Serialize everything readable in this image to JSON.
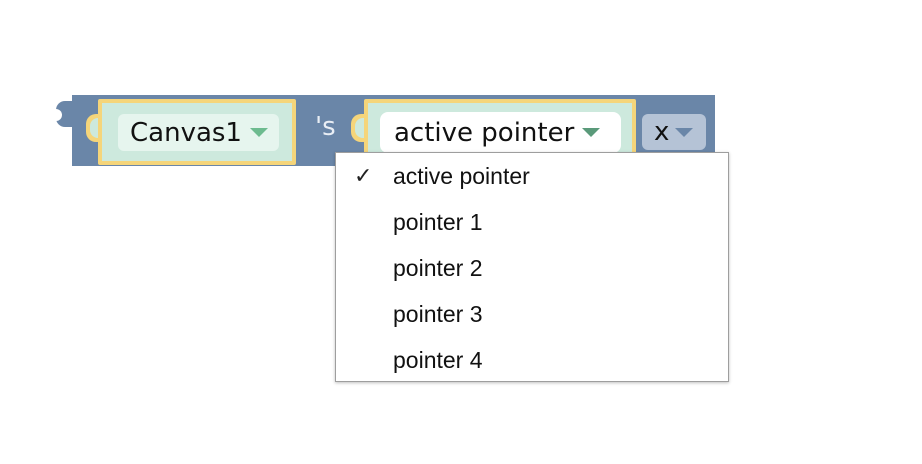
{
  "block": {
    "component": "Canvas1",
    "possessive": "'s",
    "property": "active pointer",
    "axis": "x"
  },
  "dropdown": {
    "items": [
      {
        "label": "active pointer",
        "checked": true,
        "check_glyph": "✓"
      },
      {
        "label": "pointer 1",
        "checked": false,
        "check_glyph": ""
      },
      {
        "label": "pointer 2",
        "checked": false,
        "check_glyph": ""
      },
      {
        "label": "pointer 3",
        "checked": false,
        "check_glyph": ""
      },
      {
        "label": "pointer 4",
        "checked": false,
        "check_glyph": ""
      }
    ]
  },
  "colors": {
    "block": "#6a86a8",
    "socket_outline": "#f5d57a",
    "socket_fill": "#cde9dd",
    "dropdown_arrow": "#6dbb8f"
  }
}
